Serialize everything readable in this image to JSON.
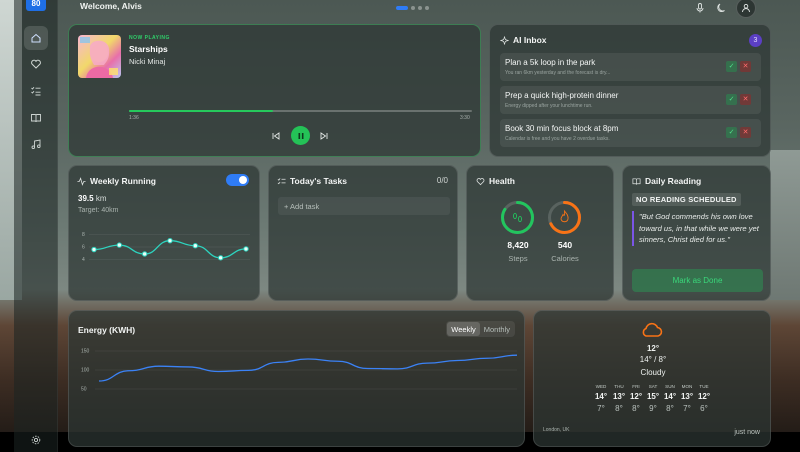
{
  "topbar": {
    "welcome": "Welcome, Alvis",
    "page_dots": 4,
    "active_dot": 0
  },
  "logo": {
    "text": "80",
    "color": "#1f6fe6"
  },
  "sidebar": {
    "items": [
      {
        "icon": "home-icon",
        "active": true
      },
      {
        "icon": "heart-icon"
      },
      {
        "icon": "checklist-icon"
      },
      {
        "icon": "book-icon"
      },
      {
        "icon": "music-note-icon"
      }
    ],
    "bottom_icon": "gear-icon"
  },
  "now_playing": {
    "label": "NOW PLAYING",
    "song": "Starships",
    "artist": "Nicki Minaj",
    "current_time": "1:36",
    "total_time": "3:30",
    "progress": 0.42,
    "accent": "#26c95c"
  },
  "ai_inbox": {
    "title": "AI Inbox",
    "count": "3",
    "items": [
      {
        "title": "Plan a 5k loop in the park",
        "subtitle": "You ran 6km yesterday and the forecast is dry..."
      },
      {
        "title": "Prep a quick high-protein dinner",
        "subtitle": "Energy dipped after your lunchtime run."
      },
      {
        "title": "Book 30 min focus block at 8pm",
        "subtitle": "Calendar is free and you have 2 overdue tasks."
      }
    ]
  },
  "running": {
    "title": "Weekly Running",
    "distance": "39.5",
    "unit": "km",
    "target": "Target: 40km",
    "toggle_on": true,
    "y_ticks": [
      "8",
      "6",
      "4"
    ],
    "values": [
      5.6,
      6.3,
      4.9,
      7.0,
      6.2,
      4.3,
      5.7
    ]
  },
  "tasks": {
    "title": "Today's Tasks",
    "count": "0/0",
    "add_label": "+ Add task"
  },
  "health": {
    "title": "Health",
    "steps_value": "8,420",
    "steps_label": "Steps",
    "steps_progress": 0.84,
    "calories_value": "540",
    "calories_label": "Calories",
    "calories_progress": 0.68
  },
  "reading": {
    "title": "Daily Reading",
    "status": "NO READING SCHEDULED",
    "quote": "\"But God commends his own love toward us, in that while we were yet sinners, Christ died for us.\"",
    "button": "Mark as Done"
  },
  "energy": {
    "title": "Energy (KWH)",
    "tabs": [
      "Weekly",
      "Monthly"
    ],
    "active_tab": "Weekly",
    "chart_data": {
      "type": "line",
      "y_ticks": [
        "150",
        "100",
        "50"
      ],
      "ylim": [
        50,
        150
      ],
      "values": [
        71,
        98,
        110,
        108,
        96,
        99,
        120,
        129,
        123,
        104,
        103,
        118,
        125,
        131,
        139
      ]
    }
  },
  "weather": {
    "temp": "12°",
    "range": "14° / 8°",
    "condition": "Cloudy",
    "location": "London, UK",
    "updated": "just now",
    "forecast": [
      {
        "day": "WED",
        "hi": "14°",
        "lo": "7°"
      },
      {
        "day": "THU",
        "hi": "13°",
        "lo": "8°"
      },
      {
        "day": "FRI",
        "hi": "12°",
        "lo": "8°"
      },
      {
        "day": "SAT",
        "hi": "15°",
        "lo": "9°"
      },
      {
        "day": "SUN",
        "hi": "14°",
        "lo": "8°"
      },
      {
        "day": "MON",
        "hi": "13°",
        "lo": "7°"
      },
      {
        "day": "TUE",
        "hi": "12°",
        "lo": "6°"
      }
    ]
  }
}
